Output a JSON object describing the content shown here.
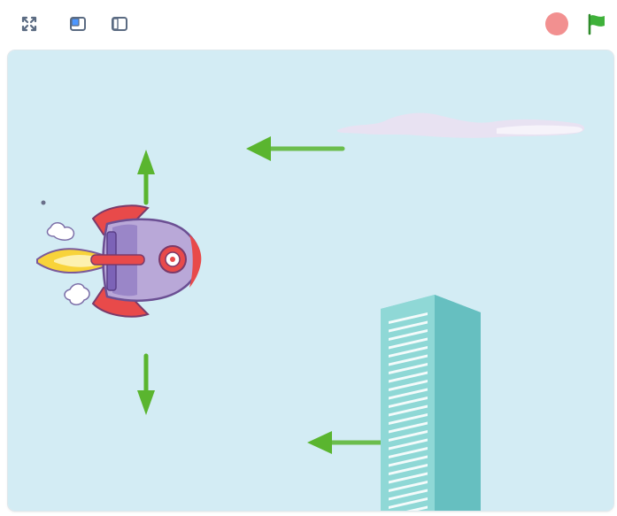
{
  "toolbar": {
    "fullscreen_icon": "fullscreen-icon",
    "small_stage_icon": "small-stage-icon",
    "normal_stage_icon": "normal-stage-icon",
    "stop_icon": "stop-icon",
    "green_flag_icon": "green-flag-icon"
  },
  "stage": {
    "backdrop_color": "#d3ecf4",
    "sprites": [
      {
        "name": "rocket",
        "icon": "rocket-icon"
      },
      {
        "name": "cloud",
        "icon": "cloud-icon"
      },
      {
        "name": "building",
        "icon": "building-icon"
      }
    ],
    "arrows": [
      {
        "direction": "up",
        "color": "#5ab52f"
      },
      {
        "direction": "down",
        "color": "#5ab52f"
      },
      {
        "direction": "left",
        "color": "#5ab52f"
      },
      {
        "direction": "left",
        "color": "#5ab52f"
      }
    ]
  },
  "colors": {
    "stop": "#f07c7c",
    "flag": "#3fb13a",
    "toolbar_icon": "#5b6b82"
  }
}
